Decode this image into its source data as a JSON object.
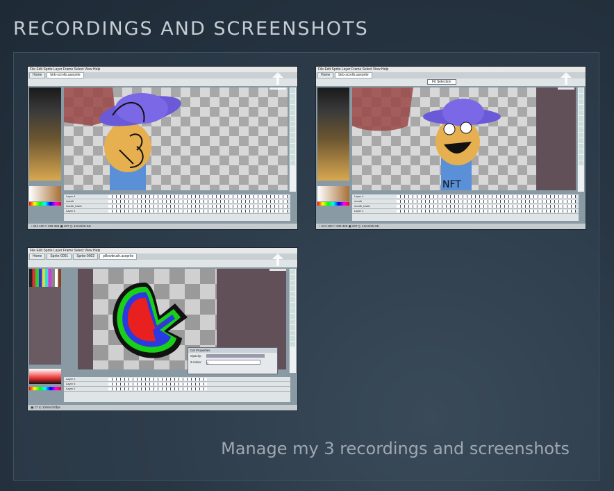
{
  "section": {
    "title": "RECORDINGS AND SCREENSHOTS"
  },
  "manage": {
    "label": "Manage my 3 recordings and screenshots"
  },
  "shots": [
    {
      "menu": "File  Edit  Sprite  Layer  Frame  Select  View  Help",
      "tabs": [
        "Home",
        "birb-scrolls.aseprite"
      ],
      "statusbar": "↑ 244 100  □ 336 369  ▣ 207  ◴ 41ms/20.34r",
      "layers": [
        "Layer 4",
        "mouth",
        "mouth_lower",
        "Layer 1"
      ],
      "frame_field": "Frame:"
    },
    {
      "menu": "File  Edit  Sprite  Layer  Frame  Select  View  Help",
      "tabs": [
        "Home",
        "birb-scrolls.aseprite"
      ],
      "statusbar": "↑ 244 120  □ 336 369  ▣ 207  ◴ 41ms/20.34r",
      "layers": [
        "Layer 4",
        "mouth",
        "mouth_lower",
        "Layer 1"
      ],
      "frame_field": "Frame:",
      "dropdown": "Fit Selection",
      "nft_text": "NFT"
    },
    {
      "menu": "File  Edit  Sprite  Layer  Frame  Select  View  Help",
      "tabs": [
        "Home",
        "Sprite-0001",
        "Sprite-0002",
        "pillowbrush.aseprite"
      ],
      "statusbar": "▣ 17  ◴ 100ms/10fps",
      "layers": [
        "Layer 1",
        "Layer 3",
        "Layer 2"
      ],
      "frame_field": "Frame:",
      "dialog": {
        "title": "Cel Properties",
        "opacity_label": "Opacity:",
        "opacity_value": "100%",
        "zindex_label": "Z-Index:",
        "zindex_value": "0"
      }
    }
  ]
}
